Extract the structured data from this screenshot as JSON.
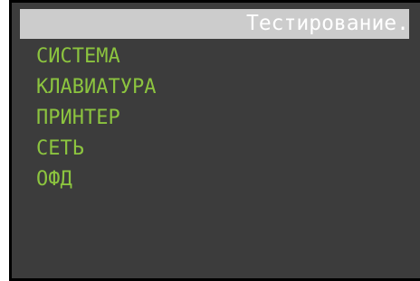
{
  "header": {
    "title": "Тестирование."
  },
  "menu": {
    "items": [
      {
        "label": "СИСТЕМА"
      },
      {
        "label": "КЛАВИАТУРА"
      },
      {
        "label": "ПРИНТЕР"
      },
      {
        "label": "СЕТЬ"
      },
      {
        "label": "ОФД"
      }
    ]
  },
  "colors": {
    "menu_text": "#8cc43f",
    "background": "#3c3c3c",
    "header_bar": "#cccccc",
    "header_text": "#ffffff"
  }
}
